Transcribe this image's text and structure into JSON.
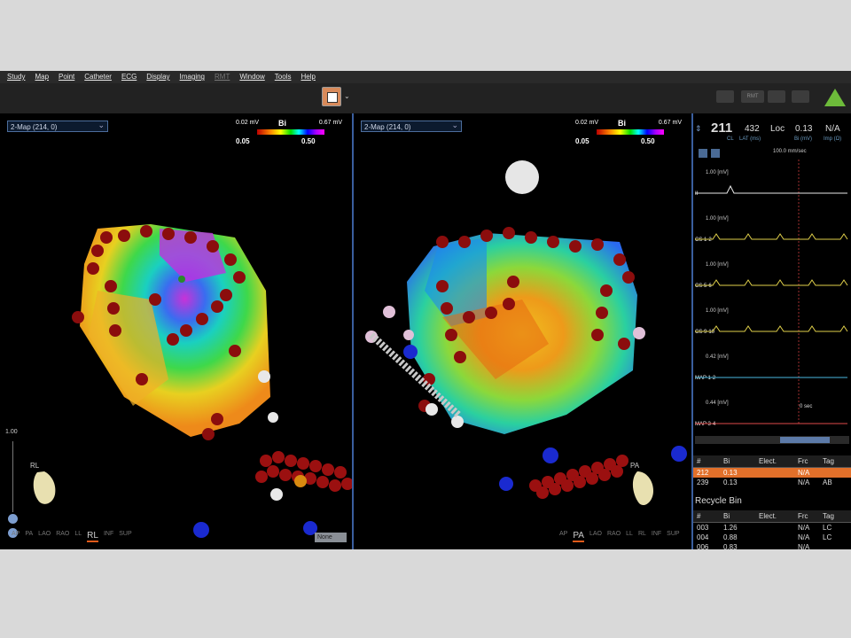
{
  "menu": [
    "Study",
    "Map",
    "Point",
    "Catheter",
    "ECG",
    "Display",
    "Imaging",
    "RMT",
    "Window",
    "Tools",
    "Help"
  ],
  "toolbar": {
    "rmt_label": "RMT"
  },
  "left_view": {
    "map_select": "2-Map (214, 0)",
    "scale": {
      "min_label": "0.02 mV",
      "title": "Bi",
      "max_label": "0.67 mV",
      "low": "0.05",
      "high": "0.50"
    },
    "slider_value": "1.00",
    "orientation_label": "RL",
    "view_tabs": [
      "AP",
      "PA",
      "LAO",
      "RAO",
      "LL",
      "RL",
      "INF",
      "SUP"
    ],
    "active_tab": "RL",
    "none_select": "None"
  },
  "right_view": {
    "map_select": "2-Map (214, 0)",
    "scale": {
      "min_label": "0.02 mV",
      "title": "Bi",
      "max_label": "0.67 mV",
      "low": "0.05",
      "high": "0.50"
    },
    "orientation_label": "PA",
    "view_tabs": [
      "AP",
      "PA",
      "LAO",
      "RAO",
      "LL",
      "RL",
      "INF",
      "SUP"
    ],
    "active_tab": "PA"
  },
  "ecg": {
    "cl": "211",
    "cl_label": "CL",
    "lat": "432",
    "lat_label": "LAT (ms)",
    "loc": "Loc",
    "bi": "0.13",
    "bi_label": "Bi (mV)",
    "imp": "N/A",
    "imp_label": "Imp (Ω)",
    "speed": "100.0 mm/sec",
    "zero_sec": "0 sec",
    "channels": [
      {
        "gain": "1.00",
        "unit": "[mV]",
        "name": "II",
        "color": "#e8e8e8"
      },
      {
        "gain": "1.00",
        "unit": "[mV]",
        "name": "CS 1-2",
        "color": "#e0d04a"
      },
      {
        "gain": "1.00",
        "unit": "[mV]",
        "name": "CS 5-6",
        "color": "#e0d04a"
      },
      {
        "gain": "1.00",
        "unit": "[mV]",
        "name": "CS 9-10",
        "color": "#e0d04a"
      },
      {
        "gain": "0.42",
        "unit": "[mV]",
        "name": "MAP 1-2",
        "color": "#4ab8e0"
      },
      {
        "gain": "0.44",
        "unit": "[mV]",
        "name": "MAP 3-4",
        "color": "#e04a4a"
      }
    ]
  },
  "points_table": {
    "headers": [
      "#",
      "Bi",
      "Elect.",
      "Frc",
      "Tag"
    ],
    "rows": [
      {
        "num": "212",
        "bi": "0.13",
        "elect": "",
        "frc": "N/A",
        "tag": ""
      },
      {
        "num": "239",
        "bi": "0.13",
        "elect": "",
        "frc": "N/A",
        "tag": "AB"
      }
    ]
  },
  "recycle_bin": {
    "title": "Recycle Bin",
    "headers": [
      "#",
      "Bi",
      "Elect.",
      "Frc",
      "Tag"
    ],
    "rows": [
      {
        "num": "003",
        "bi": "1.26",
        "elect": "",
        "frc": "N/A",
        "tag": "LC"
      },
      {
        "num": "004",
        "bi": "0.88",
        "elect": "",
        "frc": "N/A",
        "tag": "LC"
      },
      {
        "num": "006",
        "bi": "0.83",
        "elect": "",
        "frc": "N/A",
        "tag": ""
      }
    ]
  }
}
